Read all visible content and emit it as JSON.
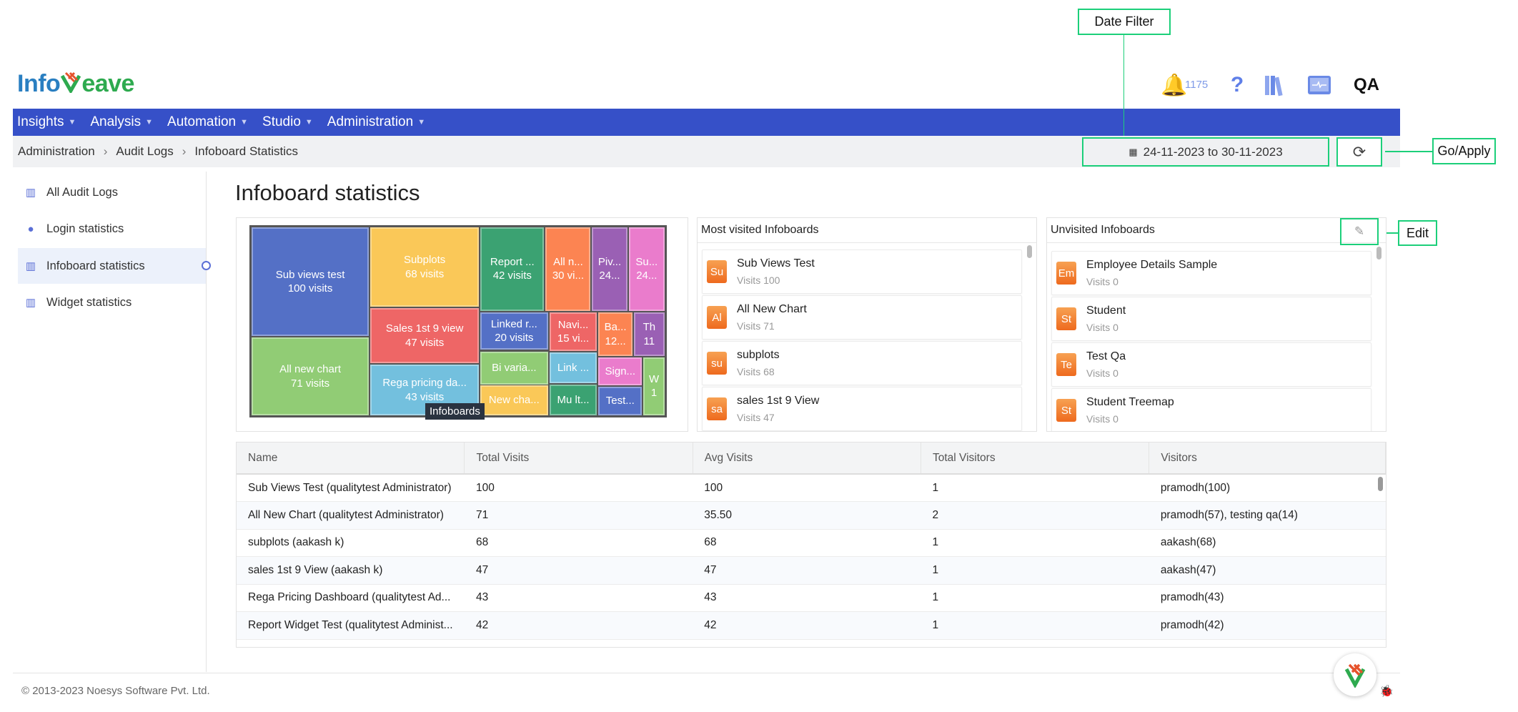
{
  "app": {
    "logo_part1": "Info",
    "logo_part2": "eave",
    "notification_count": "1175",
    "icons": [
      "bell-icon",
      "help-icon",
      "library-icon",
      "monitor-icon",
      "qa-icon"
    ]
  },
  "nav": {
    "items": [
      "Insights",
      "Analysis",
      "Automation",
      "Studio",
      "Administration"
    ]
  },
  "breadcrumb": [
    "Administration",
    "Audit Logs",
    "Infoboard Statistics"
  ],
  "date_filter": {
    "value": "24-11-2023 to 30-11-2023"
  },
  "annotations": {
    "date_filter": "Date Filter",
    "go_apply": "Go/Apply",
    "edit": "Edit"
  },
  "sidebar": {
    "items": [
      {
        "label": "All Audit Logs",
        "icon": "bar-chart-icon"
      },
      {
        "label": "Login statistics",
        "icon": "user-icon"
      },
      {
        "label": "Infoboard statistics",
        "icon": "bar-chart-icon",
        "active": true
      },
      {
        "label": "Widget statistics",
        "icon": "bar-chart-icon"
      }
    ]
  },
  "page": {
    "title": "Infoboard statistics"
  },
  "chart_data": {
    "type": "treemap",
    "tooltip": "Infoboards",
    "items": [
      {
        "name": "Sub views test",
        "label": "100 visits",
        "value": 100,
        "color": "#5470c6"
      },
      {
        "name": "All new chart",
        "label": "71 visits",
        "value": 71,
        "color": "#91cc75"
      },
      {
        "name": "Subplots",
        "label": "68 visits",
        "value": 68,
        "color": "#fac858"
      },
      {
        "name": "Sales 1st 9 view",
        "label": "47 visits",
        "value": 47,
        "color": "#ee6666"
      },
      {
        "name": "Rega pricing da...",
        "label": "43 visits",
        "value": 43,
        "color": "#73c0de"
      },
      {
        "name": "Report ...",
        "label": "42 visits",
        "value": 42,
        "color": "#3ba272"
      },
      {
        "name": "All n...",
        "label": "30 vi...",
        "value": 30,
        "color": "#fc8452"
      },
      {
        "name": "Piv...",
        "label": "24...",
        "value": 24,
        "color": "#9a60b4"
      },
      {
        "name": "Su...",
        "label": "24...",
        "value": 24,
        "color": "#ea7ccc"
      },
      {
        "name": "Linked r...",
        "label": "20 visits",
        "value": 20,
        "color": "#5470c6"
      },
      {
        "name": "Navi...",
        "label": "15 vi...",
        "value": 15,
        "color": "#ee6666"
      },
      {
        "name": "Ba...",
        "label": "12...",
        "value": 12,
        "color": "#fc8452"
      },
      {
        "name": "Th",
        "label": "11",
        "value": 11,
        "color": "#9a60b4"
      },
      {
        "name": "Bi varia...",
        "label": "",
        "color": "#91cc75"
      },
      {
        "name": "Link ...",
        "label": "",
        "color": "#73c0de"
      },
      {
        "name": "Sign...",
        "label": "",
        "color": "#ea7ccc"
      },
      {
        "name": "W",
        "label": "1",
        "color": "#91cc75"
      },
      {
        "name": "New cha...",
        "label": "",
        "color": "#fac858"
      },
      {
        "name": "Mu lt...",
        "label": "",
        "color": "#3ba272"
      },
      {
        "name": "Test...",
        "label": "",
        "color": "#5470c6"
      }
    ]
  },
  "most_visited": {
    "title": "Most visited Infoboards",
    "items": [
      {
        "initials": "Su",
        "name": "Sub Views Test",
        "visits": "Visits 100"
      },
      {
        "initials": "Al",
        "name": "All New Chart",
        "visits": "Visits 71"
      },
      {
        "initials": "su",
        "name": "subplots",
        "visits": "Visits 68"
      },
      {
        "initials": "sa",
        "name": "sales 1st 9 View",
        "visits": "Visits 47"
      }
    ]
  },
  "unvisited": {
    "title": "Unvisited Infoboards",
    "items": [
      {
        "initials": "Em",
        "name": "Employee Details Sample",
        "visits": "Visits 0"
      },
      {
        "initials": "St",
        "name": "Student",
        "visits": "Visits 0"
      },
      {
        "initials": "Te",
        "name": "Test Qa",
        "visits": "Visits 0"
      },
      {
        "initials": "St",
        "name": "Student Treemap",
        "visits": "Visits 0"
      }
    ]
  },
  "table": {
    "columns": [
      "Name",
      "Total Visits",
      "Avg Visits",
      "Total Visitors",
      "Visitors"
    ],
    "rows": [
      [
        "Sub Views Test (qualitytest Administrator)",
        "100",
        "100",
        "1",
        "pramodh(100)"
      ],
      [
        "All New Chart (qualitytest Administrator)",
        "71",
        "35.50",
        "2",
        "pramodh(57), testing qa(14)"
      ],
      [
        "subplots (aakash k)",
        "68",
        "68",
        "1",
        "aakash(68)"
      ],
      [
        "sales 1st 9 View (aakash k)",
        "47",
        "47",
        "1",
        "aakash(47)"
      ],
      [
        "Rega Pricing Dashboard (qualitytest Ad...",
        "43",
        "43",
        "1",
        "pramodh(43)"
      ],
      [
        "Report Widget Test (qualitytest Administ...",
        "42",
        "42",
        "1",
        "pramodh(42)"
      ]
    ]
  },
  "footer": {
    "copyright": "© 2013-2023 Noesys Software Pvt. Ltd."
  }
}
